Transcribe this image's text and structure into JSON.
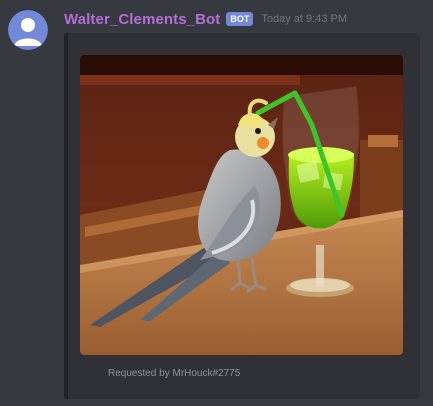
{
  "message": {
    "username": "Walter_Clements_Bot",
    "bot_tag": "BOT",
    "timestamp": "Today at 9:43 PM"
  },
  "embed": {
    "image_icon": "photo-cockatiel-drinking",
    "footer_text": "Requested by MrHouck#2775"
  },
  "colors": {
    "background": "#36393f",
    "embed_bg": "#2f3136",
    "username": "#b36fd6",
    "bot_tag": "#7289da",
    "timestamp": "#72767d",
    "avatar": "#7289da"
  }
}
